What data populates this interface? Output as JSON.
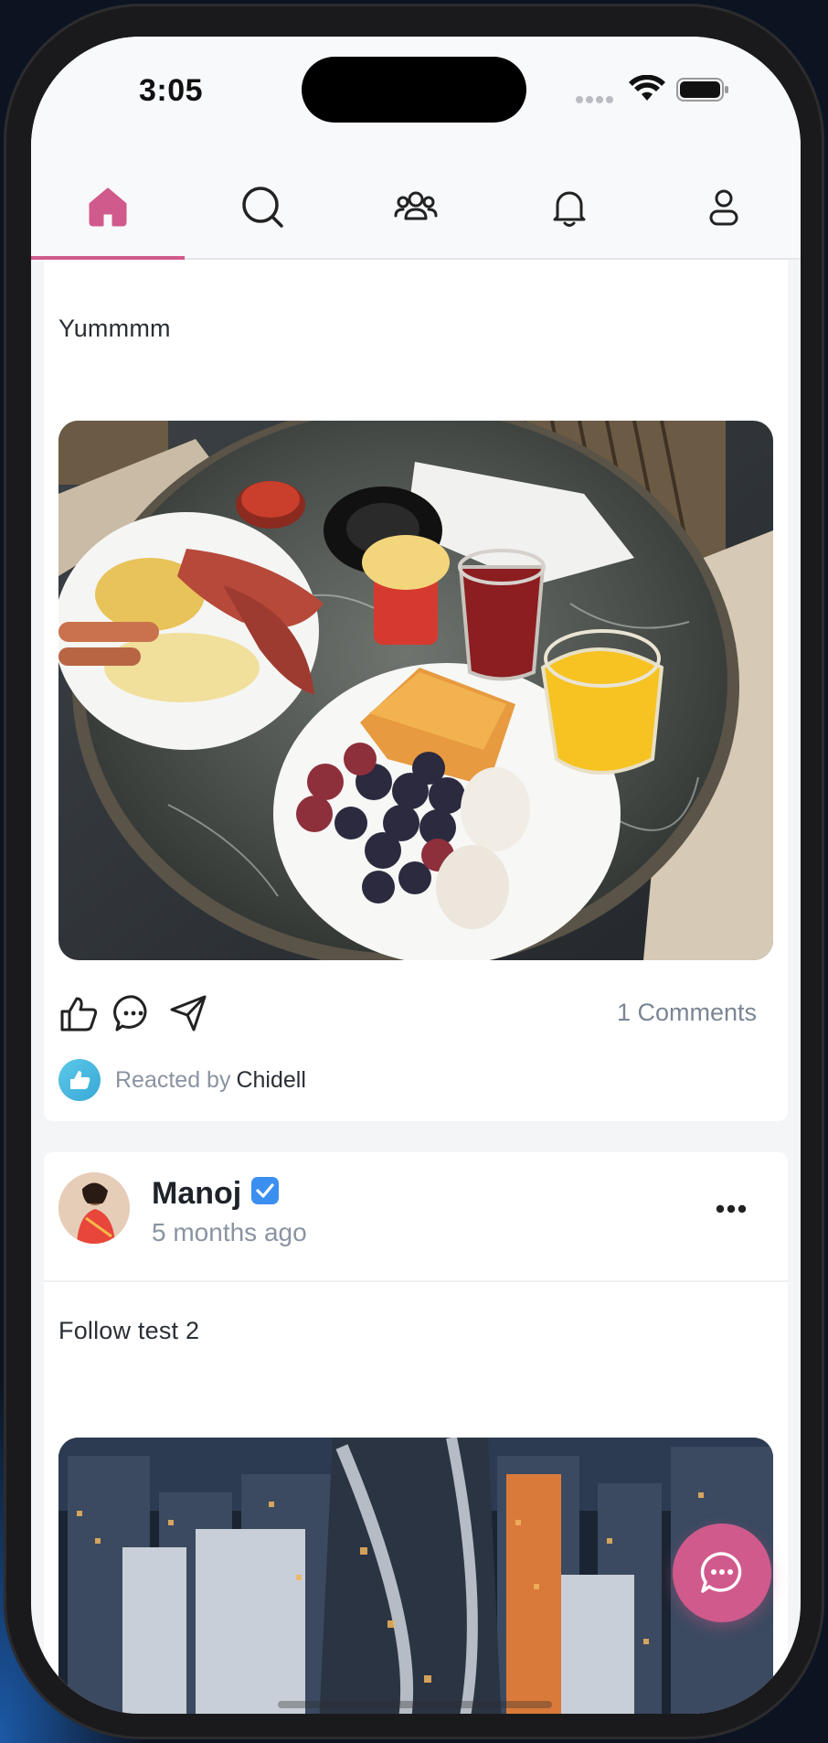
{
  "status_bar": {
    "time": "3:05"
  },
  "nav": {
    "active_color": "#d05a8c",
    "items": [
      {
        "name": "home",
        "icon": "home-icon",
        "active": true
      },
      {
        "name": "search",
        "icon": "search-icon",
        "active": false
      },
      {
        "name": "groups",
        "icon": "users-icon",
        "active": false
      },
      {
        "name": "notifications",
        "icon": "bell-icon",
        "active": false
      },
      {
        "name": "profile",
        "icon": "user-icon",
        "active": false
      }
    ]
  },
  "posts": [
    {
      "text": "Yummmm",
      "image": "breakfast-photo",
      "comments_label": "1 Comments",
      "reacted_label": "Reacted by",
      "reacted_name": "Chidell"
    },
    {
      "author": "Manoj",
      "verified": true,
      "time": "5 months ago",
      "text": "Follow test 2",
      "image": "city-night-photo"
    }
  ],
  "fab": {
    "icon": "chat-bubble-icon",
    "color": "#d05a8c"
  }
}
